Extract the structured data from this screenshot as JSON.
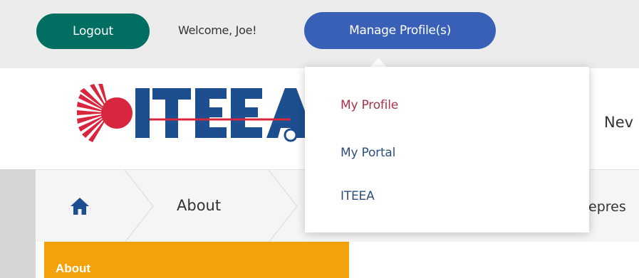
{
  "topbar": {
    "logout_label": "Logout",
    "welcome_text": "Welcome, Joe!",
    "manage_label": "Manage Profile(s)"
  },
  "header": {
    "logo_text": "ITEEA",
    "nav_partial": "Nev"
  },
  "breadcrumb": {
    "home_icon": "home-icon",
    "items": [
      "About"
    ],
    "partial_text": "epres"
  },
  "sidebar": {
    "active_label": "About"
  },
  "dropdown": {
    "items": [
      "My Profile",
      "My Portal",
      "ITEEA"
    ]
  },
  "colors": {
    "logout_bg": "#006f62",
    "manage_bg": "#3860b6",
    "logo_red": "#d7263d",
    "logo_blue": "#1d4e8f",
    "sidebar_active": "#f4a20c",
    "menu_active": "#a93349",
    "menu_link": "#2e4e7e"
  }
}
